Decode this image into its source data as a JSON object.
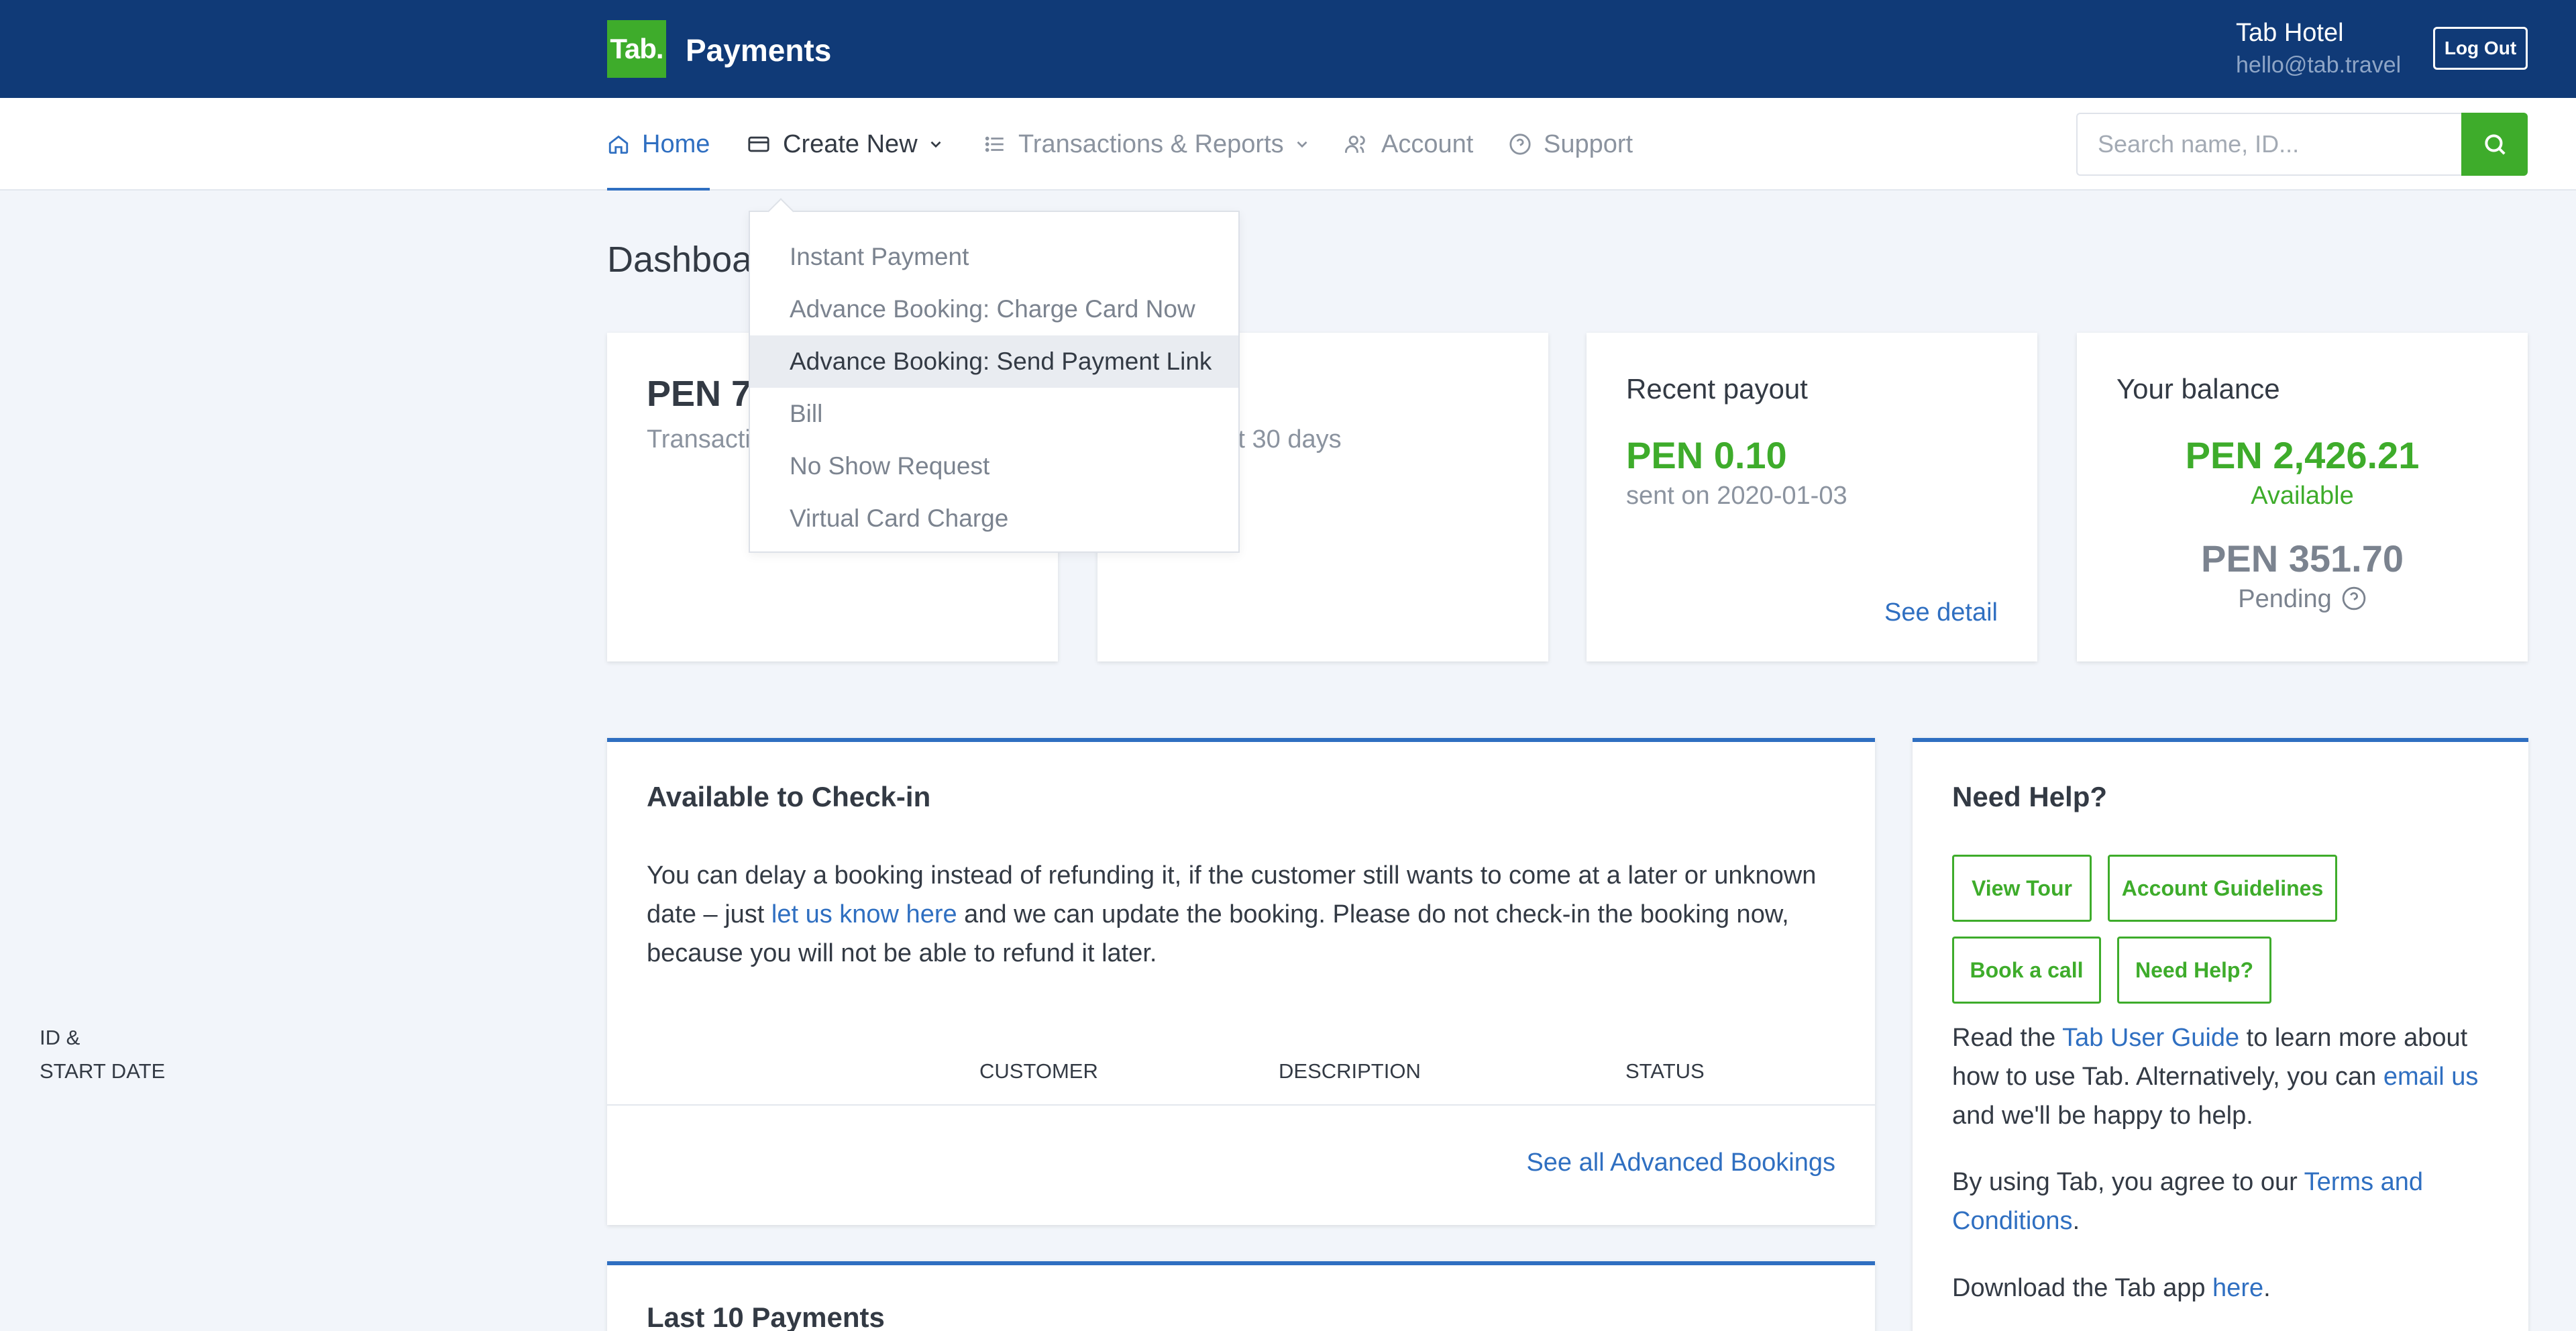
{
  "header": {
    "logo_text": "Tab.",
    "app_title": "Payments",
    "user_name": "Tab Hotel",
    "user_email": "hello@tab.travel",
    "logout_label": "Log Out",
    "bg_color": "#103a77",
    "brand_color": "#3eac2b"
  },
  "nav": {
    "home": "Home",
    "create_new": "Create New",
    "transactions": "Transactions & Reports",
    "account": "Account",
    "support": "Support",
    "search_placeholder": "Search name, ID..."
  },
  "dropdown": {
    "items": [
      "Instant Payment",
      "Advance Booking: Charge Card Now",
      "Advance Booking: Send Payment Link",
      "Bill",
      "No Show Request",
      "Virtual Card Charge"
    ],
    "highlighted_index": 2
  },
  "dashboard": {
    "heading": "Dashboa",
    "card1": {
      "amount": "PEN 79",
      "sub": "Transactio"
    },
    "card2": {
      "sub": "tions last 30 days"
    },
    "recent_payout": {
      "title": "Recent payout",
      "amount": "PEN 0.10",
      "sent": "sent on 2020-01-03",
      "link": "See detail"
    },
    "balance": {
      "title": "Your balance",
      "available_amount": "PEN 2,426.21",
      "available_label": "Available",
      "pending_amount": "PEN 351.70",
      "pending_label": "Pending"
    }
  },
  "checkin": {
    "title": "Available to Check-in",
    "text_before": "You can delay a booking instead of refunding it, if the customer still wants to come at a later or unknown date – just ",
    "text_link": "let us know here",
    "text_after": " and we can update the booking. Please do not check-in the booking now, because you will not be able to refund it later.",
    "col_id_line1": "ID &",
    "col_id_line2": "START DATE",
    "col_customer": "CUSTOMER",
    "col_description": "DESCRIPTION",
    "col_status": "STATUS",
    "see_all": "See all Advanced Bookings"
  },
  "last10": {
    "title": "Last 10 Payments"
  },
  "help": {
    "title": "Need Help?",
    "buttons": {
      "view_tour": "View Tour",
      "account_guidelines": "Account Guidelines",
      "book_call": "Book a call",
      "need_help": "Need Help?"
    },
    "p1_before": "Read the ",
    "p1_link1": "Tab User Guide",
    "p1_mid": " to learn more about how to use Tab. Alternatively, you can ",
    "p1_link2": "email us",
    "p1_after": " and we'll be happy to help.",
    "p2_before": "By using Tab, you agree to our ",
    "p2_link": "Terms and Conditions",
    "p2_after": ".",
    "p3_before": "Download the Tab app ",
    "p3_link": "here",
    "p3_after": "."
  }
}
